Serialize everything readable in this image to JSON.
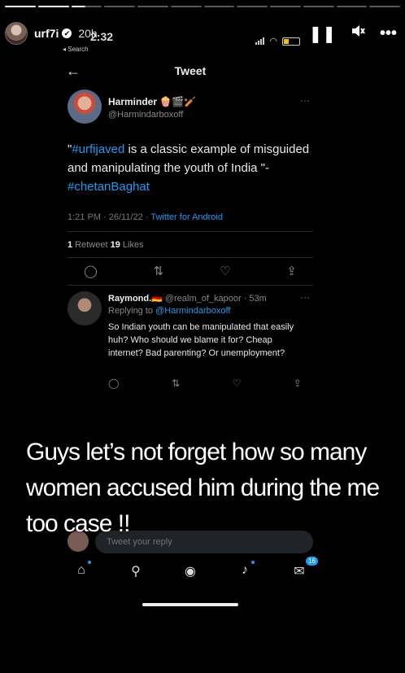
{
  "story": {
    "username": "urf7i",
    "verified_mark": "✔",
    "time_ago": "20h",
    "segments": [
      "done",
      "done",
      "half",
      "",
      "",
      "",
      "",
      "",
      "",
      "",
      "",
      ""
    ],
    "controls": {
      "pause": "❚❚",
      "mute": "🔇",
      "more": "•••"
    }
  },
  "screenshot": {
    "status_time": "2:32",
    "back_label": "◂ Search",
    "header_title": "Tweet",
    "tweet": {
      "name": "Harminder 🍿🎬🏏",
      "handle": "@Harmindarboxoff",
      "text_prefix": "\"",
      "hashtag1": "#urfijaved",
      "text_mid": " is a classic example of misguided and manipulating the youth of India \"- ",
      "hashtag2": "#chetanBaghat",
      "meta_time": "1:21 PM · 26/11/22 · ",
      "meta_source": "Twitter for Android",
      "retweets": "1",
      "retweets_label": " Retweet  ",
      "likes": "19",
      "likes_label": " Likes"
    },
    "reply": {
      "name": "Raymond.🇩🇪",
      "handle": " @realm_of_kapoor · 53m",
      "replying_prefix": "Replying to ",
      "replying_to": "@Harmindarboxoff",
      "text": "So Indian youth can be manipulated that easily huh? Who should we blame it for? Cheap internet? Bad parenting? Or unemployment?"
    },
    "composer_placeholder": "Tweet your reply",
    "notification_count": "16"
  },
  "caption": "Guys let’s not forget  how so many women accused him during the me too case !!"
}
